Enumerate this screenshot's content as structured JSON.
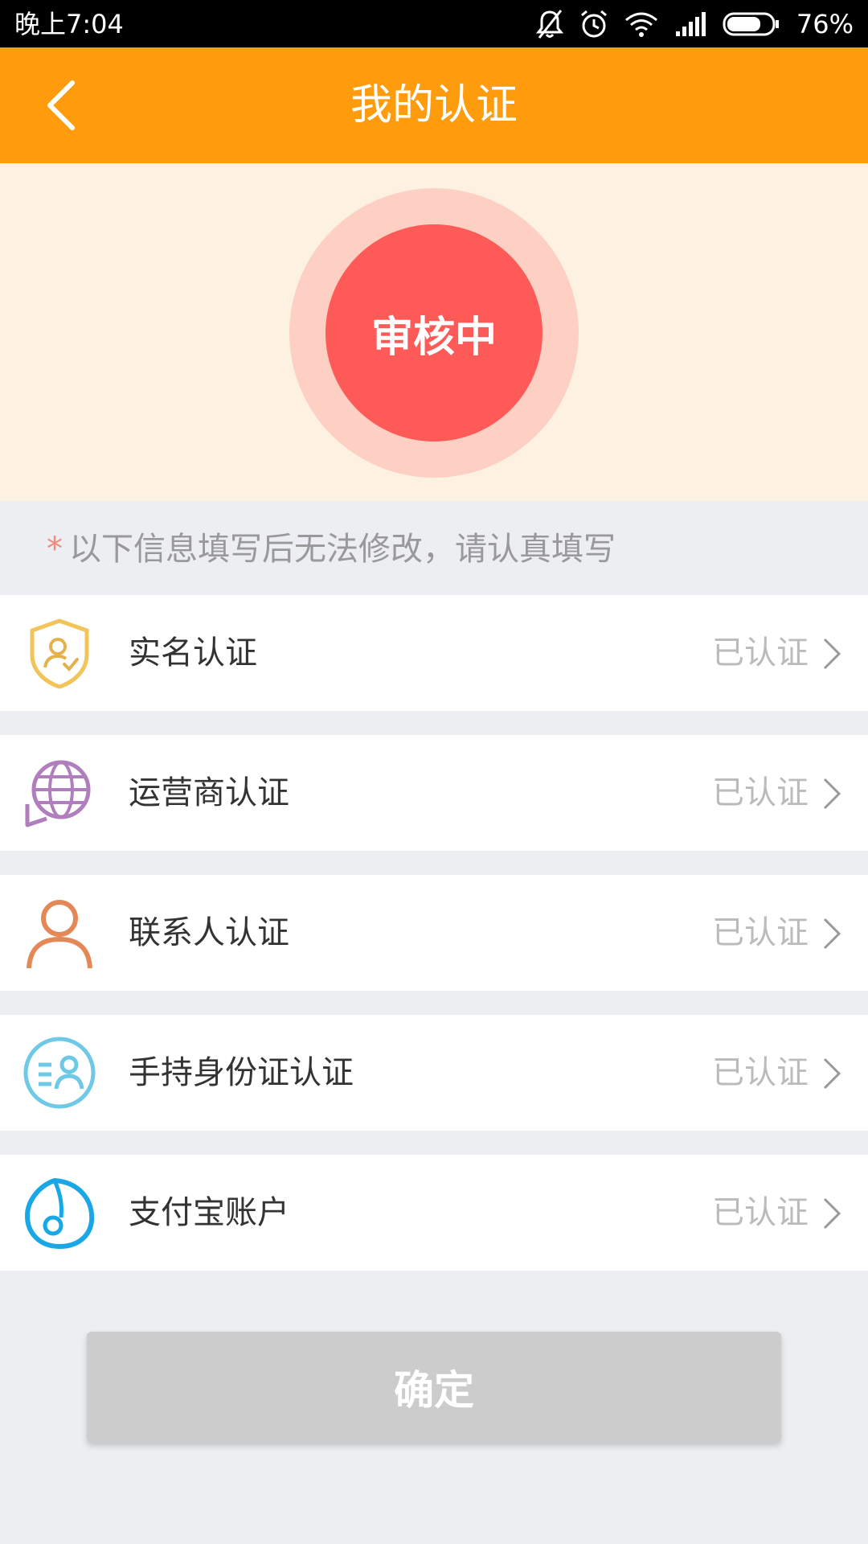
{
  "status_bar": {
    "time": "晚上7:04",
    "battery_percent": "76%",
    "battery_level": 0.76,
    "icons": [
      "mute-icon",
      "alarm-icon",
      "wifi-icon",
      "signal-icon",
      "battery-icon"
    ]
  },
  "header": {
    "title": "我的认证",
    "back_icon": "chevron-left-icon",
    "background": "#ff9c0e"
  },
  "review": {
    "status": "审核中",
    "color": "#fe5a58",
    "halo_color": "#fdd0c3"
  },
  "notice": {
    "marker": "*",
    "text": "以下信息填写后无法修改，请认真填写"
  },
  "items": [
    {
      "label": "实名认证",
      "status": "已认证",
      "icon": "shield-user-icon",
      "color": "#f2c45a"
    },
    {
      "label": "运营商认证",
      "status": "已认证",
      "icon": "globe-icon",
      "color": "#b07dbd"
    },
    {
      "label": "联系人认证",
      "status": "已认证",
      "icon": "person-icon",
      "color": "#e58857"
    },
    {
      "label": "手持身份证认证",
      "status": "已认证",
      "icon": "id-card-icon",
      "color": "#6ec9e6"
    },
    {
      "label": "支付宝账户",
      "status": "已认证",
      "icon": "alipay-icon",
      "color": "#1aa7e6"
    }
  ],
  "confirm_button": {
    "label": "确定"
  }
}
